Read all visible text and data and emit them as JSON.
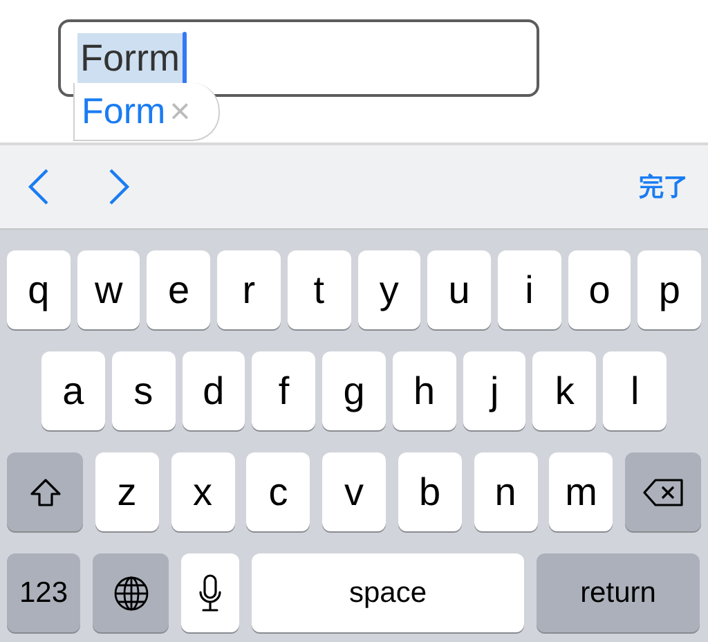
{
  "text_field": {
    "value": "Forrm",
    "selected": true
  },
  "suggestion": {
    "text": "Form",
    "dismiss": "×"
  },
  "toolbar": {
    "done": "完了"
  },
  "keyboard": {
    "rows": [
      [
        {
          "kind": "letter",
          "label": "q"
        },
        {
          "kind": "letter",
          "label": "w"
        },
        {
          "kind": "letter",
          "label": "e"
        },
        {
          "kind": "letter",
          "label": "r"
        },
        {
          "kind": "letter",
          "label": "t"
        },
        {
          "kind": "letter",
          "label": "y"
        },
        {
          "kind": "letter",
          "label": "u"
        },
        {
          "kind": "letter",
          "label": "i"
        },
        {
          "kind": "letter",
          "label": "o"
        },
        {
          "kind": "letter",
          "label": "p"
        }
      ],
      [
        {
          "kind": "letter",
          "label": "a"
        },
        {
          "kind": "letter",
          "label": "s"
        },
        {
          "kind": "letter",
          "label": "d"
        },
        {
          "kind": "letter",
          "label": "f"
        },
        {
          "kind": "letter",
          "label": "g"
        },
        {
          "kind": "letter",
          "label": "h"
        },
        {
          "kind": "letter",
          "label": "j"
        },
        {
          "kind": "letter",
          "label": "k"
        },
        {
          "kind": "letter",
          "label": "l"
        }
      ],
      [
        {
          "kind": "shift"
        },
        {
          "kind": "letter",
          "label": "z"
        },
        {
          "kind": "letter",
          "label": "x"
        },
        {
          "kind": "letter",
          "label": "c"
        },
        {
          "kind": "letter",
          "label": "v"
        },
        {
          "kind": "letter",
          "label": "b"
        },
        {
          "kind": "letter",
          "label": "n"
        },
        {
          "kind": "letter",
          "label": "m"
        },
        {
          "kind": "delete"
        }
      ]
    ],
    "bottom_bar": [
      {
        "kind": "numbers",
        "label": "123"
      },
      {
        "kind": "globe"
      },
      {
        "kind": "mic"
      },
      {
        "kind": "space",
        "label": "space"
      },
      {
        "kind": "return",
        "label": "return"
      }
    ]
  }
}
